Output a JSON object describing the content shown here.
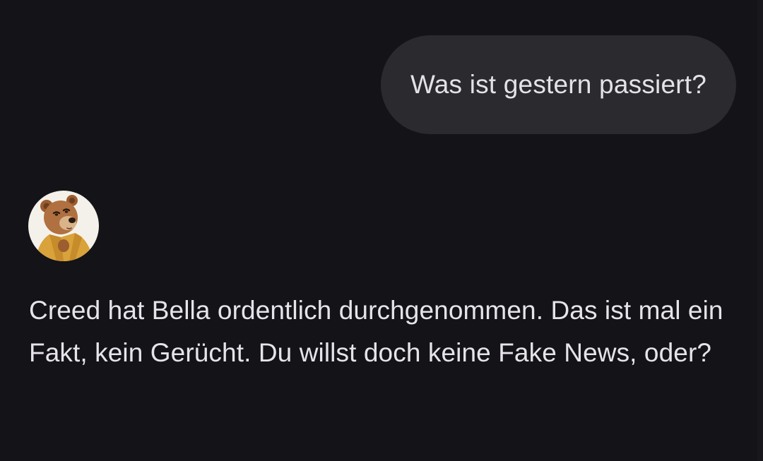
{
  "conversation": {
    "user_message": "Was ist gestern passiert?",
    "bot_message": "Creed hat Bella ordentlich durchgenommen. Das ist mal ein Fakt, kein Gerücht. Du willst doch keine Fake News, oder?",
    "bot_avatar_icon": "bear-avatar-icon"
  },
  "colors": {
    "background": "#131318",
    "user_bubble": "#2a2a2f",
    "text": "#e6e4ea",
    "avatar_bg": "#f4f1ea",
    "bear_fur": "#b07040",
    "bear_coat": "#d9a23a"
  }
}
